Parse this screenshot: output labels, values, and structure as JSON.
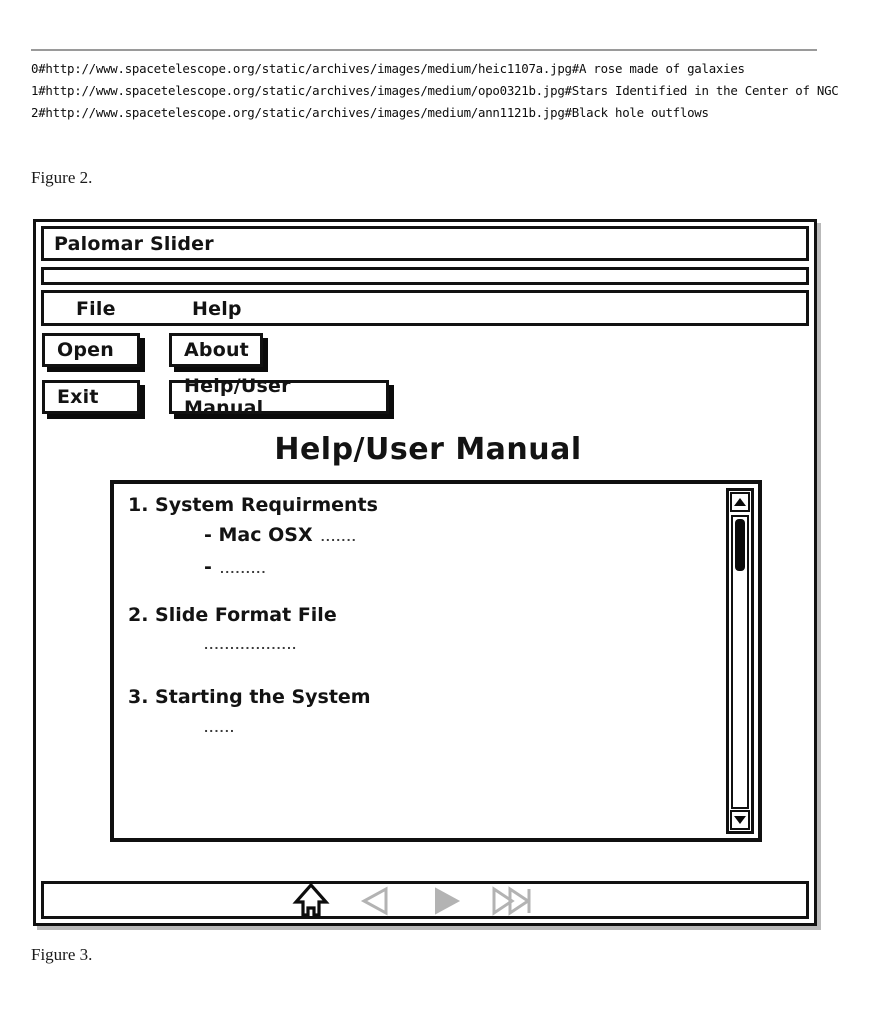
{
  "listing": {
    "lines": [
      "0#http://www.spacetelescope.org/static/archives/images/medium/heic1107a.jpg#A rose made of galaxies",
      "1#http://www.spacetelescope.org/static/archives/images/medium/opo0321b.jpg#Stars Identified in the Center of NGC",
      "2#http://www.spacetelescope.org/static/archives/images/medium/ann1121b.jpg#Black hole outflows"
    ]
  },
  "captions": {
    "figure2": "Figure 2.",
    "figure3": "Figure 3."
  },
  "window": {
    "title": "Palomar Slider",
    "menubar": {
      "file": "File",
      "help": "Help"
    },
    "file_menu": {
      "open": "Open",
      "exit": "Exit"
    },
    "help_menu": {
      "about": "About",
      "manual": "Help/User Manual"
    },
    "heading": "Help/User Manual",
    "manual": {
      "item1": "1. System Requirments",
      "item1_sub1": "-  Mac OSX",
      "item1_sub1_dots": ".......",
      "item1_sub2": "-",
      "item1_sub2_dots": ".........",
      "item2": "2. Slide Format File",
      "item2_dots": "..................",
      "item3": "3. Starting the System",
      "item3_dots": "......"
    },
    "scrollbar": {
      "up": "scroll-up",
      "down": "scroll-down"
    },
    "footer": {
      "home": "home-icon",
      "previous": "previous-icon",
      "play": "play-icon",
      "end": "skip-to-end-icon"
    }
  },
  "colors": {
    "ink": "#101010",
    "rule": "#9a9a9a",
    "gray_icon": "#b3b3b3",
    "shadow": "#b9b9b9"
  }
}
